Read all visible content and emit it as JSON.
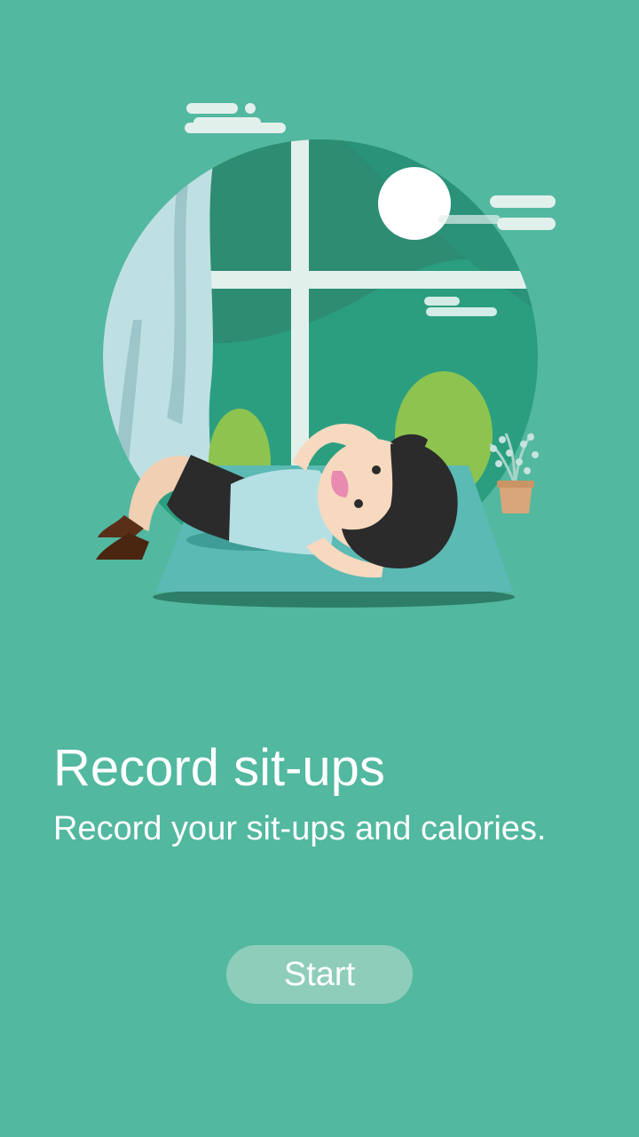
{
  "onboarding": {
    "title": "Record sit-ups",
    "subtitle": "Record your sit-ups and calories.",
    "start_button_label": "Start"
  },
  "illustration": {
    "description_icon": "person-doing-sit-ups-illustration"
  },
  "colors": {
    "background": "#52b8a0",
    "button": "#8fcdbb"
  }
}
